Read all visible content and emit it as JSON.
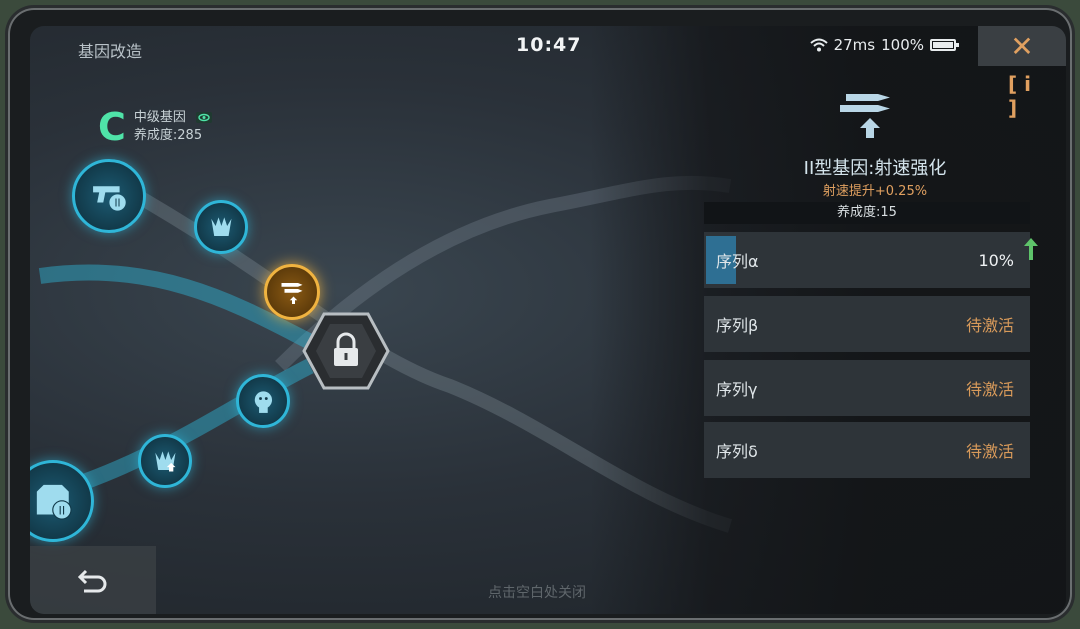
{
  "header": {
    "title": "基因改造",
    "clock": "10:47",
    "ping": "27ms",
    "battery": "100%",
    "close_icon": "close-x-icon"
  },
  "gene_tree": {
    "grade_letter": "C",
    "grade_name": "中级基因",
    "cultivation": "养成度:285",
    "nodes": [
      {
        "icon": "pistol-ii-icon",
        "state": "unlocked"
      },
      {
        "icon": "spiky-shield-icon",
        "state": "unlocked"
      },
      {
        "icon": "bullet-speed-icon",
        "state": "selected"
      },
      {
        "icon": "lock-icon",
        "state": "locked"
      },
      {
        "icon": "face-icon",
        "state": "unlocked"
      },
      {
        "icon": "spiky-upgrade-icon",
        "state": "unlocked"
      },
      {
        "icon": "armor-ii-icon",
        "state": "unlocked"
      }
    ]
  },
  "detail": {
    "gene_name": "II型基因:射速强化",
    "effect": "射速提升+0.25%",
    "cultivation": "养成度:15",
    "sequences": [
      {
        "name": "序列α",
        "value": "10%",
        "progress": 0.1
      },
      {
        "name": "序列β",
        "value": "待激活"
      },
      {
        "name": "序列γ",
        "value": "待激活"
      },
      {
        "name": "序列δ",
        "value": "待激活"
      }
    ]
  },
  "footer": {
    "hint": "点击空白处关闭"
  },
  "colors": {
    "accent_cyan": "#2fb6d8",
    "accent_orange": "#e0a060",
    "grade_green": "#4fe3a8"
  }
}
